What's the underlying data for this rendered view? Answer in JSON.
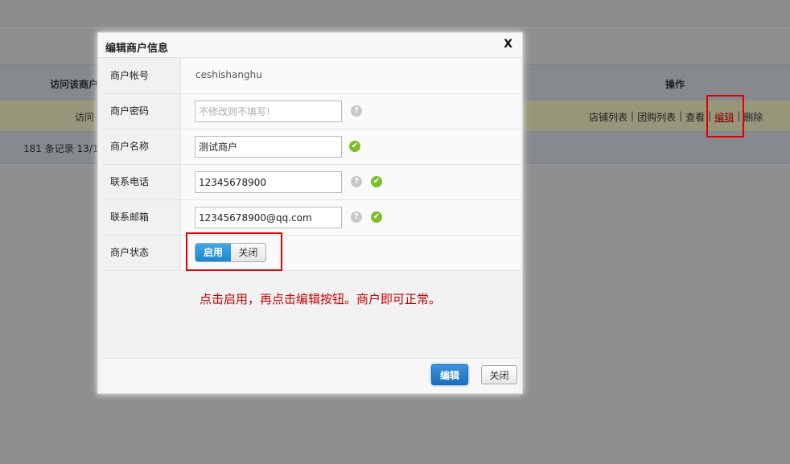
{
  "background": {
    "header_left": "访问该商户",
    "header_right": "操作",
    "row_visit": "访问",
    "operations": [
      "店铺列表",
      "团购列表",
      "查看",
      "编辑",
      "删除"
    ],
    "footer_text": "181 条记录 13/1"
  },
  "dialog": {
    "title": "编辑商户信息",
    "close_label": "X",
    "fields": {
      "account_label": "商户帐号",
      "account_value": "ceshishanghu",
      "password_label": "商户密码",
      "password_placeholder": "不修改则不填写!",
      "name_label": "商户名称",
      "name_value": "测试商户",
      "phone_label": "联系电话",
      "phone_value": "12345678900",
      "email_label": "联系邮箱",
      "email_value": "12345678900@qq.com",
      "status_label": "商户状态",
      "status_on": "启用",
      "status_off": "关闭"
    },
    "hint": "点击启用，再点击编辑按钮。商户即可正常。",
    "edit_button": "编辑",
    "close_button": "关闭"
  },
  "icons": {
    "help": "?",
    "ok": "✔"
  },
  "colors": {
    "accent": "#1a86cf",
    "annotation": "#e00000",
    "ok": "#7cbd2a"
  }
}
